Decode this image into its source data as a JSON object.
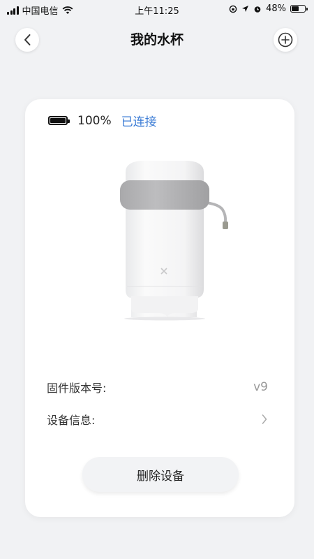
{
  "status_bar": {
    "carrier": "中国电信",
    "time": "上午11:25",
    "battery": "48%",
    "battery_level": 0.48
  },
  "nav": {
    "title": "我的水杯",
    "back_icon": "chevron-left-icon",
    "add_icon": "plus-circle-icon"
  },
  "device": {
    "battery_percent": "100%",
    "battery_level": 1.0,
    "connection_status": "已连接",
    "accent_color": "#3a7bd5"
  },
  "info": {
    "firmware_label": "固件版本号:",
    "firmware_value": "v9",
    "device_info_label": "设备信息:"
  },
  "actions": {
    "delete_label": "删除设备"
  }
}
